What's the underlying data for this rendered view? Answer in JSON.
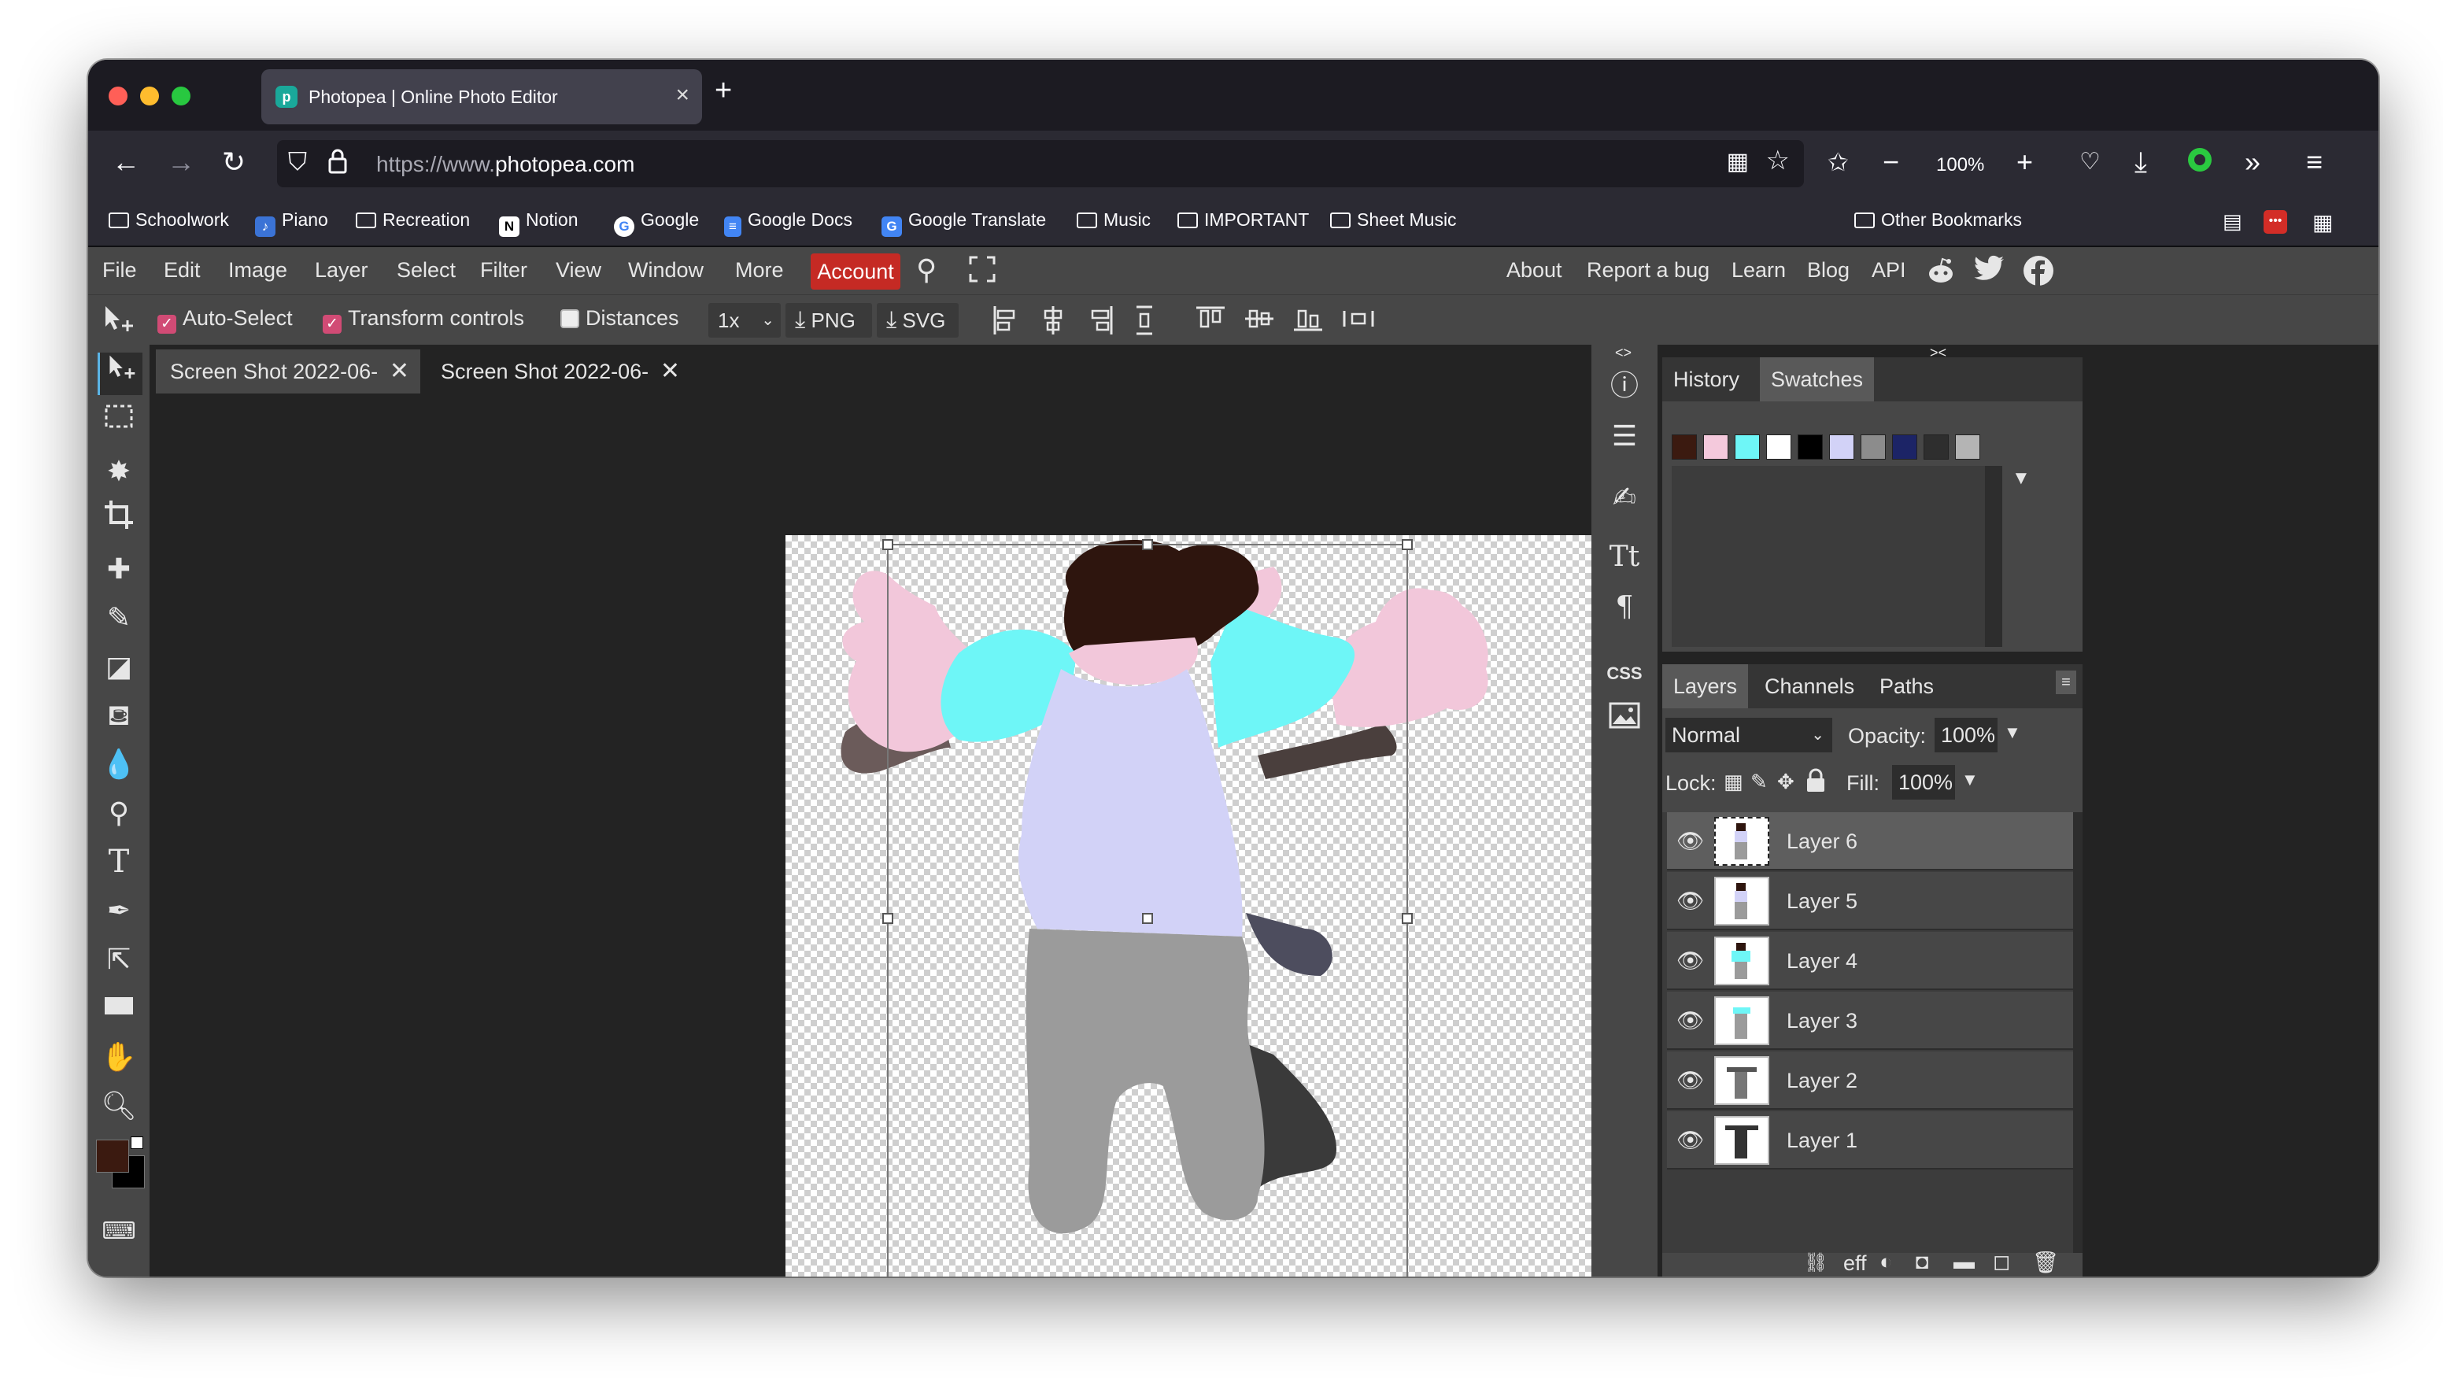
{
  "browser": {
    "tab_title": "Photopea | Online Photo Editor",
    "url_prefix": "https://www.",
    "url_domain": "photopea.com",
    "zoom": "100%",
    "bookmarks": [
      "Schoolwork",
      "Piano",
      "Recreation",
      "Notion",
      "Google",
      "Google Docs",
      "Google Translate",
      "Music",
      "IMPORTANT",
      "Sheet Music"
    ],
    "other_bookmarks": "Other Bookmarks"
  },
  "menu": {
    "items": [
      "File",
      "Edit",
      "Image",
      "Layer",
      "Select",
      "Filter",
      "View",
      "Window",
      "More"
    ],
    "account": "Account",
    "right_items": [
      "About",
      "Report a bug",
      "Learn",
      "Blog",
      "API"
    ]
  },
  "options": {
    "auto_select": "Auto-Select",
    "transform_controls": "Transform controls",
    "distances": "Distances",
    "scale": "1x",
    "png": "PNG",
    "svg": "SVG"
  },
  "documents": {
    "tabs": [
      "Screen Shot 2022-06-",
      "Screen Shot 2022-06-"
    ]
  },
  "panels": {
    "top_tabs": [
      "History",
      "Swatches"
    ],
    "swatch_colors": [
      "#3b1a10",
      "#f4c9dc",
      "#6ef6f7",
      "#ffffff",
      "#000000",
      "#d2d2f7",
      "#8c8c8c",
      "#1c2466",
      "#2e2e2e",
      "#b4b4b4"
    ],
    "layer_tabs": [
      "Layers",
      "Channels",
      "Paths"
    ],
    "blend_mode": "Normal",
    "opacity_label": "Opacity:",
    "opacity_value": "100%",
    "lock_label": "Lock:",
    "fill_label": "Fill:",
    "fill_value": "100%",
    "layers": [
      "Layer 6",
      "Layer 5",
      "Layer 4",
      "Layer 3",
      "Layer 2",
      "Layer 1"
    ],
    "effects_label": "eff",
    "css_label": "CSS"
  },
  "colors": {
    "accent": "#c52a24",
    "checkbox": "#d14b75",
    "foreground": "#3b1a10",
    "background": "#000000"
  }
}
